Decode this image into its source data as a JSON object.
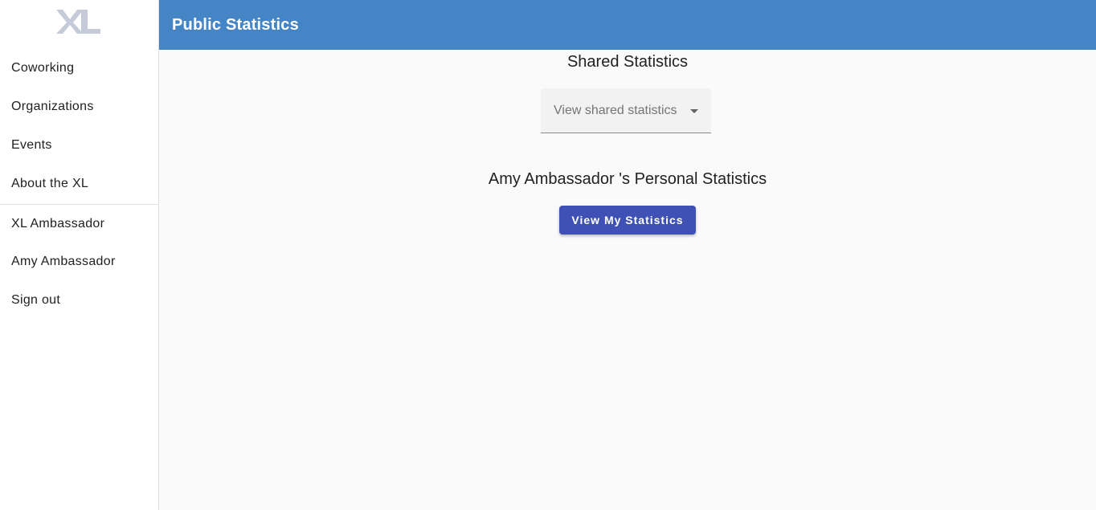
{
  "sidebar": {
    "logo": "XL",
    "primary_items": [
      {
        "label": "Coworking"
      },
      {
        "label": "Organizations"
      },
      {
        "label": "Events"
      },
      {
        "label": "About the XL"
      }
    ],
    "secondary_items": [
      {
        "label": "XL Ambassador"
      },
      {
        "label": "Amy Ambassador"
      },
      {
        "label": "Sign out"
      }
    ]
  },
  "header": {
    "title": "Public Statistics",
    "color": "#4585c6"
  },
  "main": {
    "shared_title": "Shared Statistics",
    "shared_select": {
      "placeholder": "View shared statistics",
      "icon": "chevron-down-icon"
    },
    "personal_title": "Amy Ambassador 's Personal Statistics",
    "view_button": "View My Statistics",
    "button_color": "#3f51b5"
  }
}
